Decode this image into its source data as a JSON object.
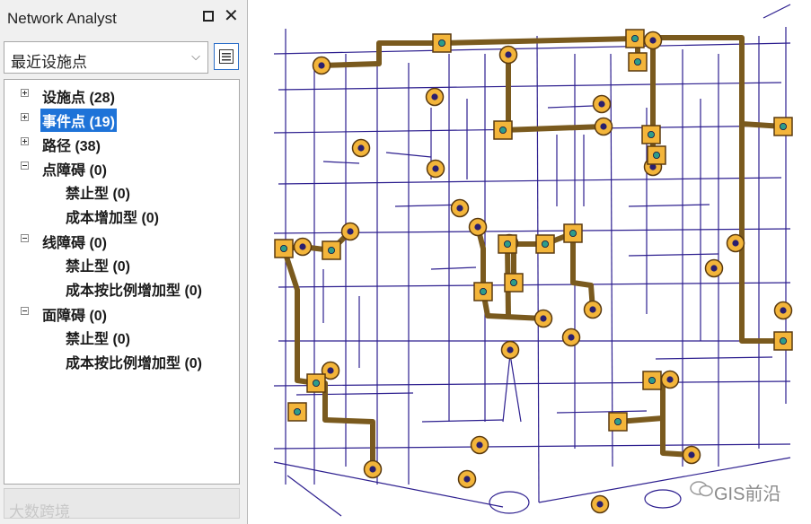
{
  "panel": {
    "title": "Network Analyst",
    "close_glyph": "✕",
    "combo_value": "最近设施点",
    "combo_arrow": "⌵",
    "props_icon": "layer-properties-icon"
  },
  "tree": [
    {
      "label": "设施点 (28)",
      "state": "collapsed",
      "selected": false,
      "children": []
    },
    {
      "label": "事件点 (19)",
      "state": "collapsed",
      "selected": true,
      "children": []
    },
    {
      "label": "路径 (38)",
      "state": "collapsed",
      "selected": false,
      "children": []
    },
    {
      "label": "点障碍 (0)",
      "state": "expanded",
      "selected": false,
      "children": [
        "禁止型 (0)",
        "成本增加型 (0)"
      ]
    },
    {
      "label": "线障碍 (0)",
      "state": "expanded",
      "selected": false,
      "children": [
        "禁止型 (0)",
        "成本按比例增加型 (0)"
      ]
    },
    {
      "label": "面障碍 (0)",
      "state": "expanded",
      "selected": false,
      "children": [
        "禁止型 (0)",
        "成本按比例增加型 (0)"
      ]
    }
  ],
  "watermarks": {
    "left": "大数跨境",
    "right": "GIS前沿"
  },
  "colors": {
    "street": "#2d1f8f",
    "route": "#7a5a1e",
    "facility_fill": "#f3b53a",
    "facility_dot": "#2e9c8a",
    "incident_fill": "#f3b53a",
    "incident_dot": "#2a1f6e",
    "selection": "#1e73d8"
  }
}
